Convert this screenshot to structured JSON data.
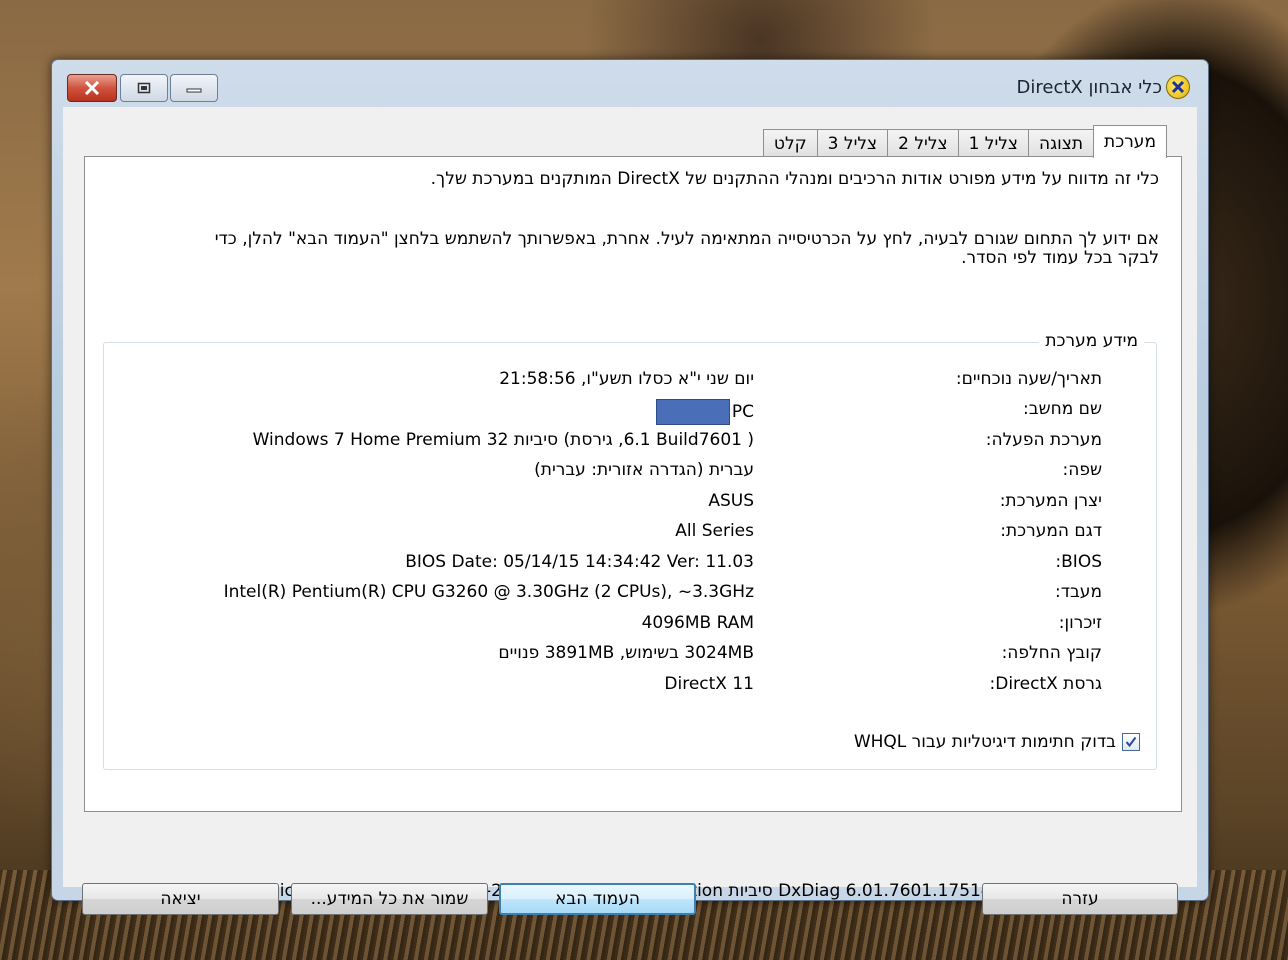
{
  "window": {
    "title": "כלי אבחון DirectX"
  },
  "tabs": [
    {
      "label": "מערכת",
      "active": true
    },
    {
      "label": "תצוגה",
      "active": false
    },
    {
      "label": "צליל 1",
      "active": false
    },
    {
      "label": "צליל 2",
      "active": false
    },
    {
      "label": "צליל 3",
      "active": false
    },
    {
      "label": "קלט",
      "active": false
    }
  ],
  "intro": {
    "line1": "כלי זה מדווח על מידע מפורט אודות הרכיבים ומנהלי ההתקנים של DirectX המותקנים במערכת שלך.",
    "line2": "אם ידוע לך התחום שגורם לבעיה, לחץ על הכרטיסייה המתאימה לעיל.  אחרת, באפשרותך להשתמש בלחצן \"העמוד הבא\" להלן, כדי",
    "line3": "לבקר בכל עמוד לפי הסדר."
  },
  "system_info": {
    "group_label": "מידע מערכת",
    "rows": [
      {
        "key": "תאריך/שעה נוכחיים:",
        "value": "יום שני י\"א כסלו תשע\"ו, 21:58:56"
      },
      {
        "key": "שם מחשב:",
        "value": "PC"
      },
      {
        "key": "מערכת הפעלה:",
        "value": "Windows 7 Home Premium 32 סיביות (6.1, גירסת Build7601 )"
      },
      {
        "key": "שפה:",
        "value": "עברית (הגדרה אזורית: עברית)"
      },
      {
        "key": "יצרן המערכת:",
        "value": "ASUS"
      },
      {
        "key": "דגם המערכת:",
        "value": "All Series"
      },
      {
        "key": "BIOS:",
        "value": "BIOS Date: 05/14/15 14:34:42 Ver: 11.03"
      },
      {
        "key": "מעבד:",
        "value": "Intel(R) Pentium(R) CPU G3260 @ 3.30GHz (2 CPUs), ~3.3GHz"
      },
      {
        "key": "זיכרון:",
        "value": "4096MB RAM"
      },
      {
        "key": "קובץ החלפה:",
        "value": "3024MB בשימוש, 3891MB פנויים"
      },
      {
        "key": "גרסת DirectX:",
        "value": "DirectX 11"
      }
    ],
    "whql_label": "בדוק חתימות דיגיטליות עבור WHQL",
    "whql_checked": true
  },
  "copyright": "DxDiag 6.01.7601.17514 32 סיביות Unicode  Copyright © 1998-2006 Microsoft Corporation.  כל הזכויות שמורות.",
  "buttons": {
    "help": "עזרה",
    "next": "העמוד הבא",
    "save": "שמור את כל המידע...",
    "exit": "יציאה"
  }
}
